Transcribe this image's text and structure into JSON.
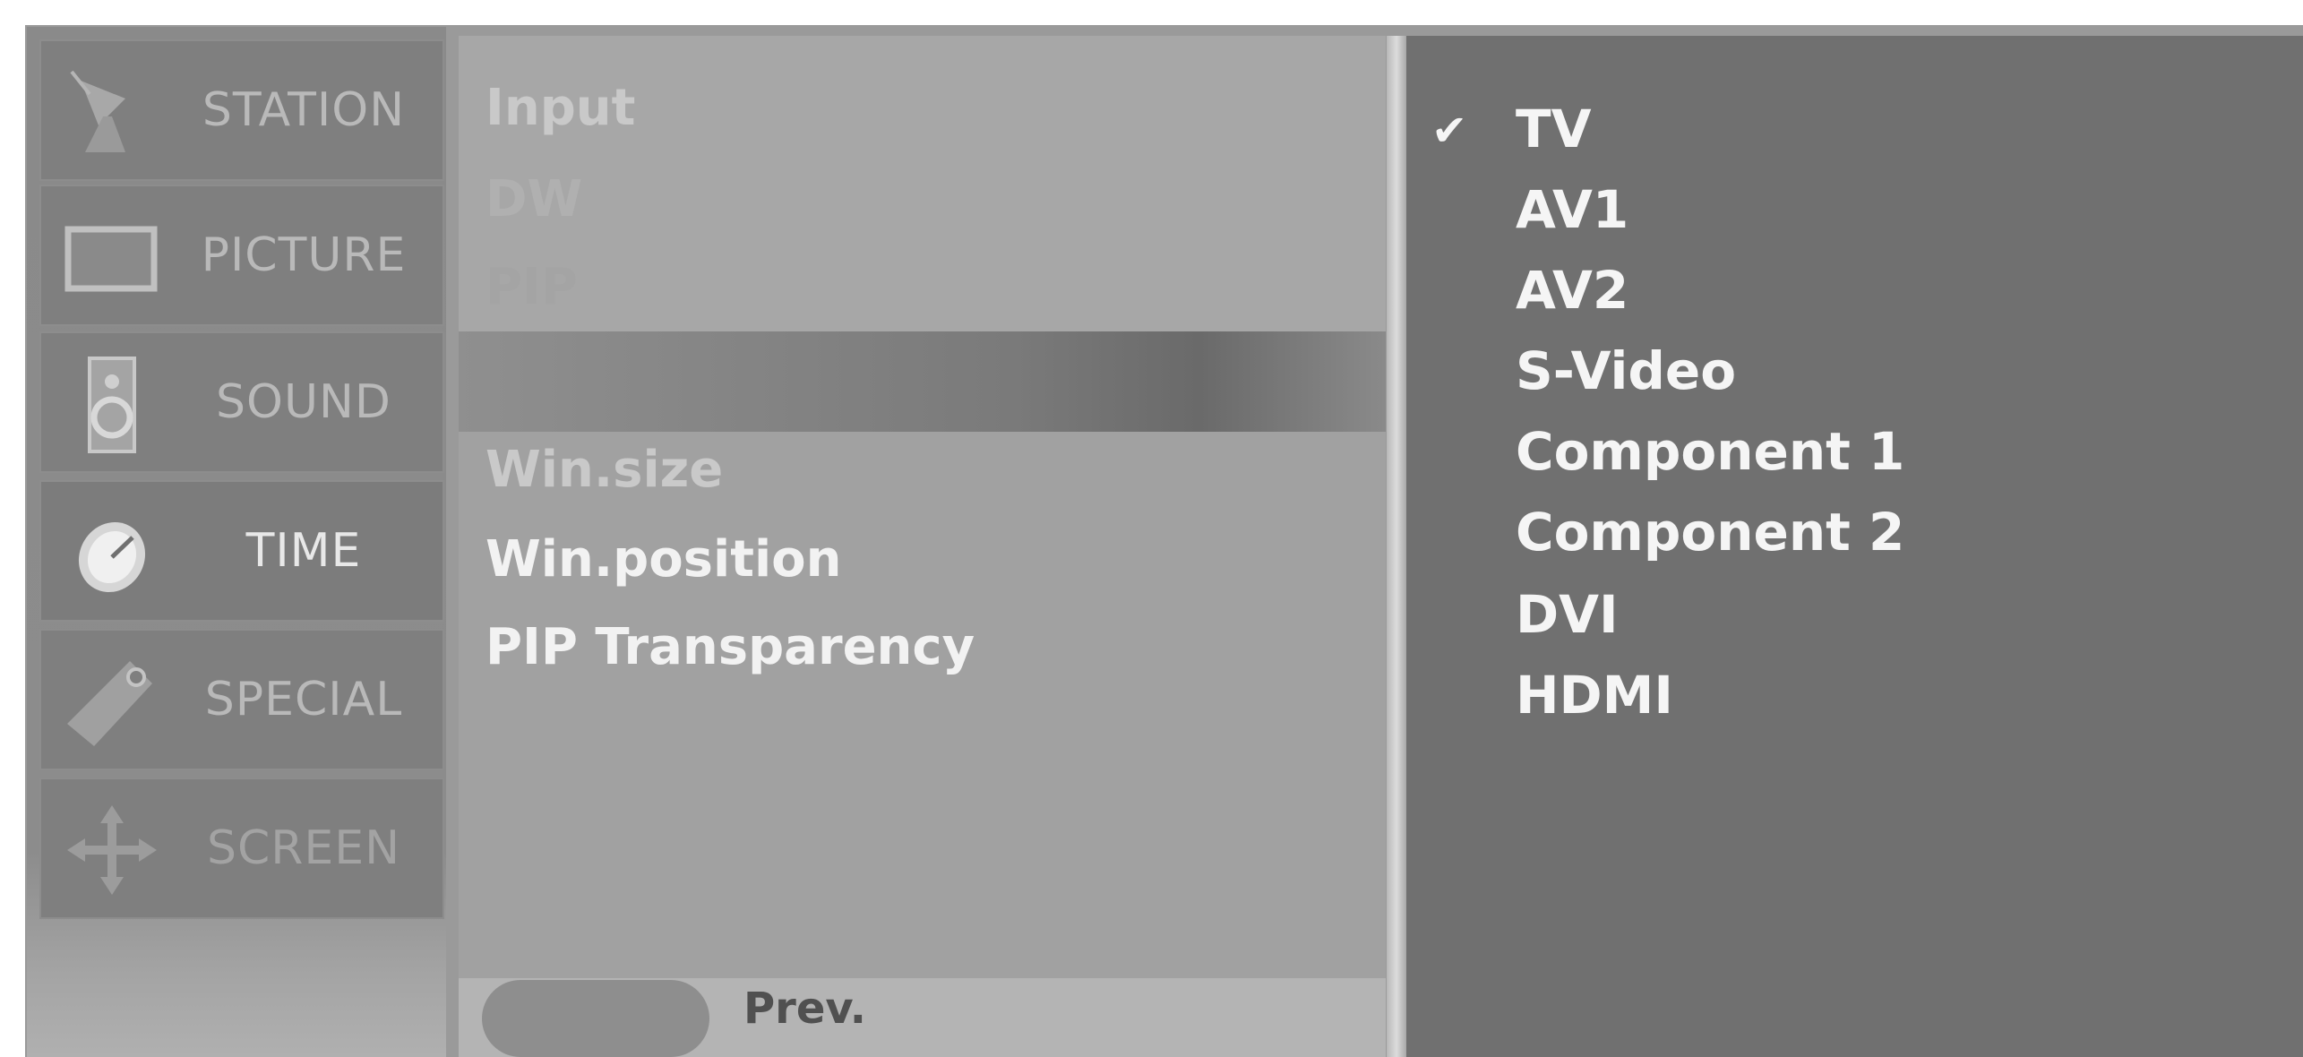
{
  "sidebar": {
    "items": [
      {
        "label": "STATION",
        "icon": "satellite-dish-icon"
      },
      {
        "label": "PICTURE",
        "icon": "tv-screen-icon"
      },
      {
        "label": "SOUND",
        "icon": "speaker-icon"
      },
      {
        "label": "TIME",
        "icon": "clock-icon"
      },
      {
        "label": "SPECIAL",
        "icon": "tag-icon"
      },
      {
        "label": "SCREEN",
        "icon": "move-arrows-icon"
      }
    ],
    "active": "TIME"
  },
  "submenu": {
    "items": [
      {
        "label": "Input"
      },
      {
        "label": "DW"
      },
      {
        "label": "PIP"
      },
      {
        "label": "Win.size"
      },
      {
        "label": "Win.position"
      },
      {
        "label": "PIP Transparency"
      }
    ]
  },
  "footer": {
    "prev_label": "Prev."
  },
  "options": {
    "items": [
      "TV",
      "AV1",
      "AV2",
      "S-Video",
      "Component 1",
      "Component 2",
      "DVI",
      "HDMI"
    ],
    "selected": "TV",
    "check_glyph": "✔"
  }
}
